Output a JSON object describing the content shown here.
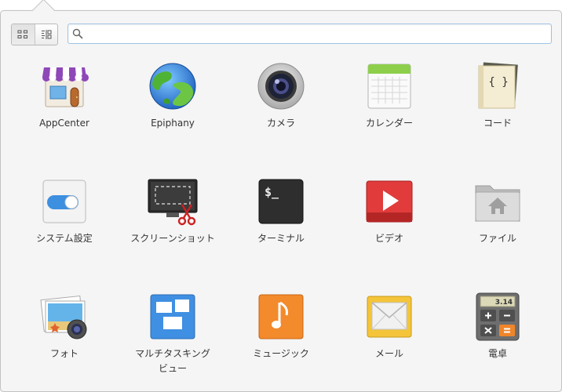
{
  "search": {
    "placeholder": "",
    "value": ""
  },
  "view_switch": {
    "active": "grid"
  },
  "apps": [
    {
      "label": "AppCenter"
    },
    {
      "label": "Epiphany"
    },
    {
      "label": "カメラ"
    },
    {
      "label": "カレンダー"
    },
    {
      "label": "コード"
    },
    {
      "label": "システム設定"
    },
    {
      "label": "スクリーンショット"
    },
    {
      "label": "ターミナル"
    },
    {
      "label": "ビデオ"
    },
    {
      "label": "ファイル"
    },
    {
      "label": "フォト"
    },
    {
      "label": "マルチタスキング\nビュー"
    },
    {
      "label": "ミュージック"
    },
    {
      "label": "メール"
    },
    {
      "label": "電卓"
    }
  ],
  "icons": {
    "terminal_prompt": "$_",
    "calculator_display": "3.14",
    "code_braces": "{ }"
  }
}
